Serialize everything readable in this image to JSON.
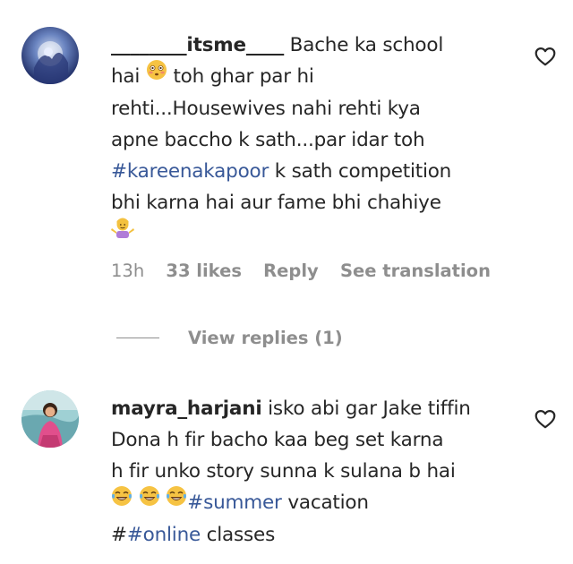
{
  "comments": [
    {
      "username": "________itsme____",
      "lines": {
        "l1": " Bache ka school",
        "l2a": "hai ",
        "l2b": " toh ghar par hi",
        "l3": "rehti...Housewives nahi rehti kya",
        "l4": "apne baccho k sath...par idar toh",
        "l5_tag": "#kareenakapoor",
        "l5_rest": " k sath competition",
        "l6": "bhi karna hai aur fame bhi chahiye"
      },
      "meta": {
        "time": "13h",
        "likes": "33 likes",
        "reply": "Reply",
        "translate": "See translation"
      },
      "view_replies": "View replies (1)"
    },
    {
      "username": "mayra_harjani",
      "lines": {
        "l1": " isko abi gar Jake tiffin",
        "l2": "Dona h fir bacho kaa beg set karna",
        "l3": "h fir unko story sunna k sulana b hai",
        "l4_tag": "#summer",
        "l4_rest": " vacation",
        "l5_prefix": "#",
        "l5_tag": "#online",
        "l5_rest": " classes"
      }
    }
  ],
  "colors": {
    "text": "#262626",
    "meta": "#8e8e8e",
    "hashtag": "#385898"
  },
  "icons": [
    "heart-outline-icon",
    "flushed-face-emoji",
    "person-shrugging-emoji",
    "tears-of-joy-emoji"
  ]
}
